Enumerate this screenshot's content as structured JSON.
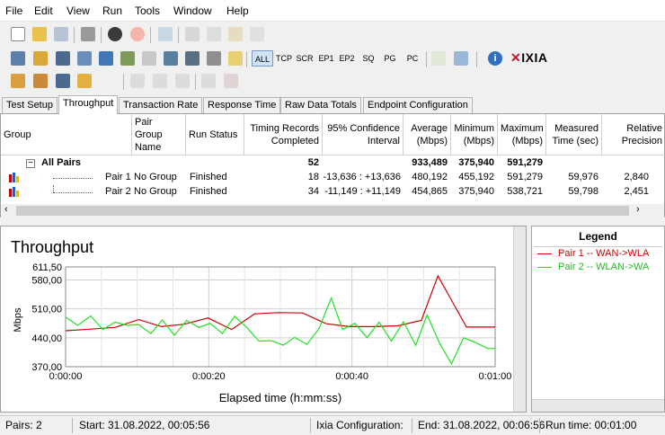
{
  "menu": [
    "File",
    "Edit",
    "View",
    "Run",
    "Tools",
    "Window",
    "Help"
  ],
  "toolbar": {
    "filters": [
      "ALL",
      "TCP",
      "SCR",
      "EP1",
      "EP2",
      "SQ",
      "PG",
      "PC"
    ],
    "active_filter": "ALL",
    "brand": "IXIA"
  },
  "tabs": [
    "Test Setup",
    "Throughput",
    "Transaction Rate",
    "Response Time",
    "Raw Data Totals",
    "Endpoint Configuration"
  ],
  "active_tab": "Throughput",
  "grid": {
    "headers": [
      [
        "Group",
        ""
      ],
      [
        "Pair Group",
        "Name"
      ],
      [
        "Run Status",
        ""
      ],
      [
        "Timing Records",
        "Completed"
      ],
      [
        "95% Confidence",
        "Interval"
      ],
      [
        "Average",
        "(Mbps)"
      ],
      [
        "Minimum",
        "(Mbps)"
      ],
      [
        "Maximum",
        "(Mbps)"
      ],
      [
        "Measured",
        "Time (sec)"
      ],
      [
        "Relative",
        "Precision"
      ]
    ],
    "all_pairs": {
      "label": "All Pairs",
      "records": "52",
      "average": "933,489",
      "minimum": "375,940",
      "maximum": "591,279",
      "expand": "−"
    },
    "rows": [
      {
        "pair": "Pair 1",
        "group": "No Group",
        "status": "Finished",
        "records": "18",
        "ci": "-13,636 : +13,636",
        "average": "480,192",
        "minimum": "455,192",
        "maximum": "591,279",
        "time": "59,976",
        "precision": "2,840"
      },
      {
        "pair": "Pair 2",
        "group": "No Group",
        "status": "Finished",
        "records": "34",
        "ci": "-11,149 : +11,149",
        "average": "454,865",
        "minimum": "375,940",
        "maximum": "538,721",
        "time": "59,798",
        "precision": "2,451"
      }
    ]
  },
  "chart_data": {
    "type": "line",
    "title": "Throughput",
    "xlabel": "Elapsed time (h:mm:ss)",
    "ylabel": "Mbps",
    "xlim": [
      0,
      60
    ],
    "ylim": [
      370,
      611.5
    ],
    "x_ticks": [
      "0:00:00",
      "0:00:20",
      "0:00:40",
      "0:01:00"
    ],
    "y_ticks": [
      "611,50",
      "580,00",
      "510,00",
      "440,00",
      "370,00"
    ],
    "y_tick_values": [
      611.5,
      580,
      510,
      440,
      370
    ],
    "series": [
      {
        "name": "Pair 1 -- WAN->WLA",
        "color": "#d00000",
        "x": [
          0,
          3.5,
          6.9,
          10.2,
          13.4,
          16.6,
          19.9,
          23.2,
          26.4,
          29.7,
          33.1,
          36.4,
          39.7,
          43.1,
          46.4,
          49.7,
          52.0,
          56.0,
          60.0
        ],
        "y": [
          457,
          461,
          465,
          484,
          467,
          473,
          488,
          460,
          498,
          501,
          500,
          474,
          467,
          467,
          469,
          482,
          590,
          466,
          466
        ]
      },
      {
        "name": "Pair 2 -- WLAN->WA",
        "color": "#22e022",
        "x": [
          0,
          1.7,
          3.5,
          5.2,
          6.9,
          8.6,
          10.2,
          11.9,
          13.5,
          15.2,
          16.9,
          18.6,
          20.2,
          21.9,
          23.6,
          25.3,
          27.0,
          28.7,
          30.4,
          32.0,
          33.7,
          35.4,
          37.1,
          38.7,
          40.4,
          42.1,
          43.8,
          45.5,
          47.2,
          48.9,
          50.5,
          52.2,
          53.9,
          55.6,
          57.3,
          59.0,
          60.0
        ],
        "y": [
          490,
          470,
          493,
          460,
          478,
          470,
          472,
          450,
          483,
          446,
          482,
          465,
          475,
          450,
          492,
          465,
          432,
          433,
          422,
          441,
          424,
          462,
          536,
          460,
          475,
          440,
          478,
          432,
          479,
          422,
          495,
          428,
          377,
          440,
          428,
          414,
          414
        ]
      }
    ]
  },
  "legend": {
    "title": "Legend"
  },
  "status": {
    "pairs": "Pairs: 2",
    "start": "Start: 31.08.2022, 00:05:56",
    "ixia": "Ixia Configuration:",
    "end": "End: 31.08.2022, 00:06:56",
    "runtime": "Run time: 00:01:00"
  },
  "colors": {
    "selected_tab_bg": "#ffffff",
    "pair1": "#d00000",
    "pair2": "#22e022",
    "grid_line": "#cfcfcf",
    "brand_red": "#c8102e"
  }
}
